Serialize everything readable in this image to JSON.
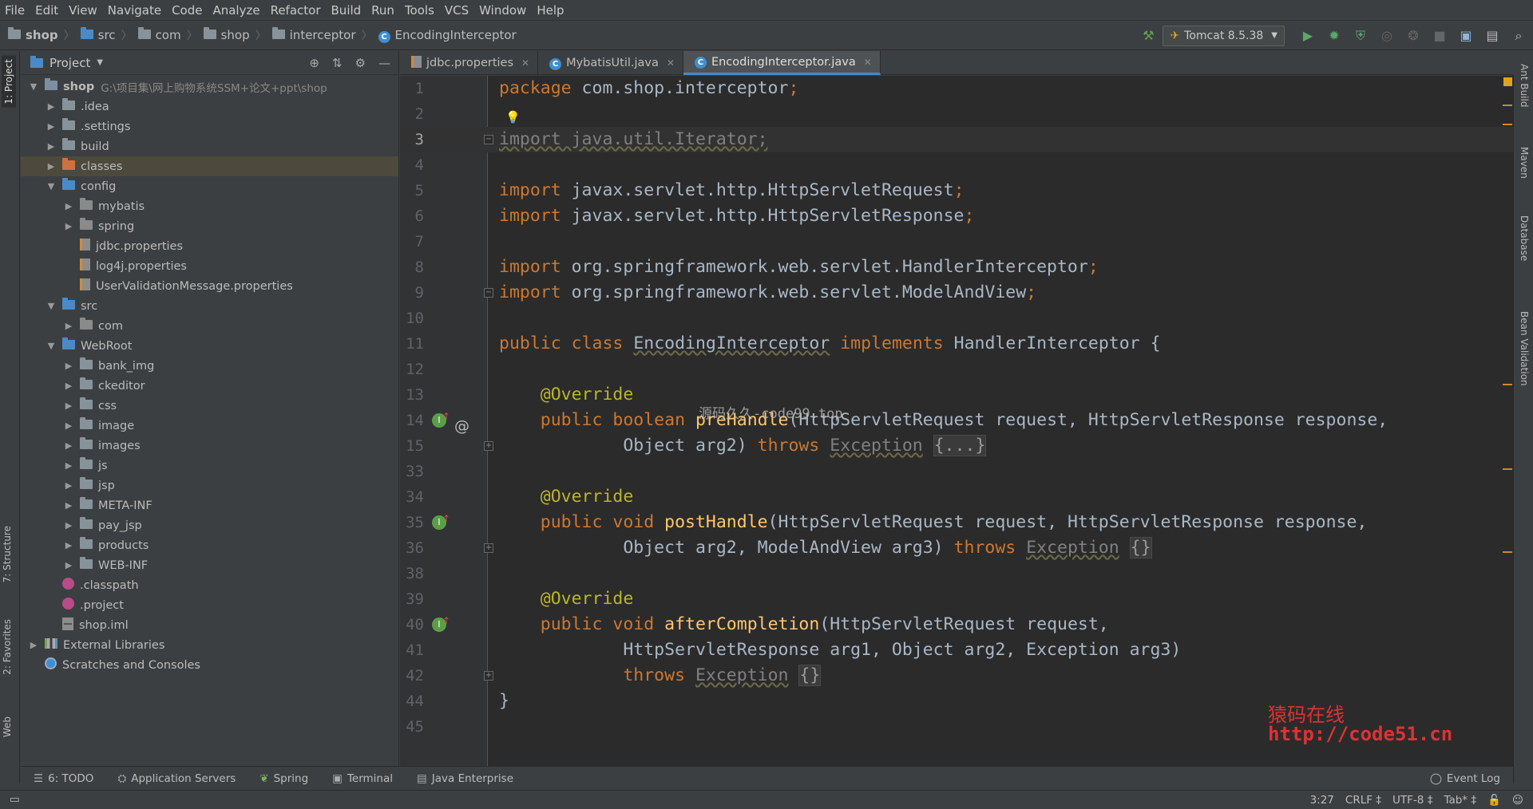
{
  "menu": [
    "File",
    "Edit",
    "View",
    "Navigate",
    "Code",
    "Analyze",
    "Refactor",
    "Build",
    "Run",
    "Tools",
    "VCS",
    "Window",
    "Help"
  ],
  "breadcrumb": [
    "shop",
    "src",
    "com",
    "shop",
    "interceptor",
    "EncodingInterceptor"
  ],
  "run_config": "Tomcat 8.5.38",
  "left_tabs": {
    "project": "1: Project",
    "structure": "7: Structure",
    "favorites": "2: Favorites",
    "web": "Web"
  },
  "right_tabs": [
    "Ant Build",
    "Maven",
    "Database",
    "Bean Validation"
  ],
  "project_panel": {
    "title": "Project",
    "tree": [
      {
        "label": "shop",
        "path": "G:\\项目集\\网上购物系统SSM+论文+ppt\\shop",
        "depth": 0,
        "open": true,
        "icon": "module",
        "bold": true
      },
      {
        "label": ".idea",
        "depth": 1,
        "open": false,
        "icon": "folder"
      },
      {
        "label": ".settings",
        "depth": 1,
        "open": false,
        "icon": "folder"
      },
      {
        "label": "build",
        "depth": 1,
        "open": false,
        "icon": "folder"
      },
      {
        "label": "classes",
        "depth": 1,
        "open": false,
        "icon": "folder-orange",
        "selected": true
      },
      {
        "label": "config",
        "depth": 1,
        "open": true,
        "icon": "folder-blue"
      },
      {
        "label": "mybatis",
        "depth": 2,
        "open": false,
        "icon": "package"
      },
      {
        "label": "spring",
        "depth": 2,
        "open": false,
        "icon": "package"
      },
      {
        "label": "jdbc.properties",
        "depth": 2,
        "leaf": true,
        "icon": "properties"
      },
      {
        "label": "log4j.properties",
        "depth": 2,
        "leaf": true,
        "icon": "properties"
      },
      {
        "label": "UserValidationMessage.properties",
        "depth": 2,
        "leaf": true,
        "icon": "properties"
      },
      {
        "label": "src",
        "depth": 1,
        "open": true,
        "icon": "folder-blue"
      },
      {
        "label": "com",
        "depth": 2,
        "open": false,
        "icon": "package"
      },
      {
        "label": "WebRoot",
        "depth": 1,
        "open": true,
        "icon": "web"
      },
      {
        "label": "bank_img",
        "depth": 2,
        "open": false,
        "icon": "folder"
      },
      {
        "label": "ckeditor",
        "depth": 2,
        "open": false,
        "icon": "folder"
      },
      {
        "label": "css",
        "depth": 2,
        "open": false,
        "icon": "folder"
      },
      {
        "label": "image",
        "depth": 2,
        "open": false,
        "icon": "folder"
      },
      {
        "label": "images",
        "depth": 2,
        "open": false,
        "icon": "folder"
      },
      {
        "label": "js",
        "depth": 2,
        "open": false,
        "icon": "folder"
      },
      {
        "label": "jsp",
        "depth": 2,
        "open": false,
        "icon": "folder"
      },
      {
        "label": "META-INF",
        "depth": 2,
        "open": false,
        "icon": "folder"
      },
      {
        "label": "pay_jsp",
        "depth": 2,
        "open": false,
        "icon": "folder"
      },
      {
        "label": "products",
        "depth": 2,
        "open": false,
        "icon": "folder"
      },
      {
        "label": "WEB-INF",
        "depth": 2,
        "open": false,
        "icon": "folder"
      },
      {
        "label": ".classpath",
        "depth": 1,
        "leaf": true,
        "icon": "classpath"
      },
      {
        "label": ".project",
        "depth": 1,
        "leaf": true,
        "icon": "classpath"
      },
      {
        "label": "shop.iml",
        "depth": 1,
        "leaf": true,
        "icon": "file"
      },
      {
        "label": "External Libraries",
        "depth": 0,
        "open": false,
        "icon": "library"
      },
      {
        "label": "Scratches and Consoles",
        "depth": 0,
        "leaf": true,
        "icon": "scratch"
      }
    ]
  },
  "editor_tabs": [
    {
      "label": "jdbc.properties",
      "icon": "properties"
    },
    {
      "label": "MybatisUtil.java",
      "icon": "class"
    },
    {
      "label": "EncodingInterceptor.java",
      "icon": "class",
      "active": true
    }
  ],
  "code": {
    "line_numbers": [
      "1",
      "2",
      "3",
      "4",
      "5",
      "6",
      "7",
      "8",
      "9",
      "10",
      "11",
      "12",
      "13",
      "14",
      "15",
      "33",
      "34",
      "35",
      "36",
      "38",
      "39",
      "40",
      "41",
      "42",
      "44",
      "45"
    ],
    "package_kw": "package",
    "package_name": " com.shop.interceptor",
    "semi": ";",
    "import_kw": "import",
    "imp_iterator": "import java.util.Iterator;",
    "imp1": " javax.servlet.http.HttpServletRequest",
    "imp2": " javax.servlet.http.HttpServletResponse",
    "imp3": " org.springframework.web.servlet.HandlerInterceptor",
    "imp4": " org.springframework.web.servlet.ModelAndView",
    "public_kw": "public",
    "class_kw": "class",
    "class_name": "EncodingInterceptor",
    "implements_kw": "implements",
    "iface": "HandlerInterceptor {",
    "override": "@Override",
    "boolean_kw": "boolean",
    "void_kw": "void",
    "m1": "preHandle",
    "m1_args": "(HttpServletRequest request, HttpServletResponse response,",
    "m1_args2": "Object arg2) ",
    "throws_kw": "throws",
    "exception": "Exception",
    "folded_body": "{...}",
    "empty_body": "{}",
    "m2": "postHandle",
    "m2_args": "(HttpServletRequest request, HttpServletResponse response,",
    "m2_args2": "Object arg2, ModelAndView arg3) ",
    "m3": "afterCompletion",
    "m3_args": "(HttpServletRequest request,",
    "m3_args2": "HttpServletResponse arg1, Object arg2, Exception arg3)",
    "close_brace": "}",
    "comma": ","
  },
  "watermarks": {
    "center": "源码久久-code99.top",
    "red_name": "猿码在线",
    "red_url": "http://code51.cn"
  },
  "bottom_tabs": [
    "6: TODO",
    "Application Servers",
    "Spring",
    "Terminal",
    "Java Enterprise"
  ],
  "event_log": "Event Log",
  "status": {
    "position": "3:27",
    "line_sep": "CRLF ‡",
    "encoding": "UTF-8 ‡",
    "indent": "Tab* ‡"
  }
}
